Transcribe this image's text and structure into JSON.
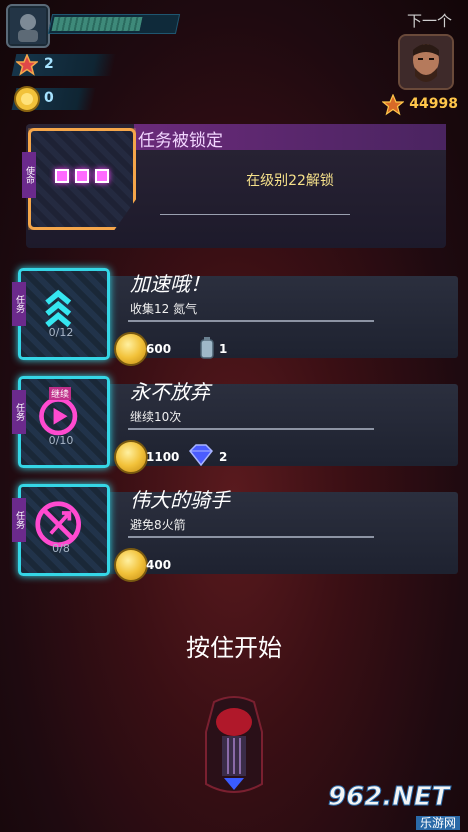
{
  "hud": {
    "player_level_progress": 0.7,
    "gem_count": "2",
    "coin_count": "0",
    "next_label": "下一个",
    "rival_score": "44998"
  },
  "locked_mission": {
    "title": "任务被锁定",
    "ribbon": "使命",
    "description": "在级别22解锁"
  },
  "missions": [
    {
      "ribbon": "任务",
      "title": "加速哦！",
      "desc": "收集12 氮气",
      "progress": "0/12",
      "coin_reward": "600",
      "item_reward": "1",
      "item_icon": "nitro-canister-icon"
    },
    {
      "ribbon": "任务",
      "title": "永不放弃",
      "desc": "继续10次",
      "progress": "0/10",
      "coin_reward": "1100",
      "item_reward": "2",
      "item_icon": "diamond-icon",
      "icon_label": "继续"
    },
    {
      "ribbon": "任务",
      "title": "伟大的骑手",
      "desc": "避免8火箭",
      "progress": "0/8",
      "coin_reward": "400"
    }
  ],
  "start_prompt": "按住开始",
  "watermark": {
    "number": "962.NET",
    "sub": "乐游网"
  },
  "colors": {
    "accent": "#35d6e6",
    "locked": "#f5a64a",
    "ribbon": "#6b2a8c",
    "gold": "#ffc64a"
  }
}
